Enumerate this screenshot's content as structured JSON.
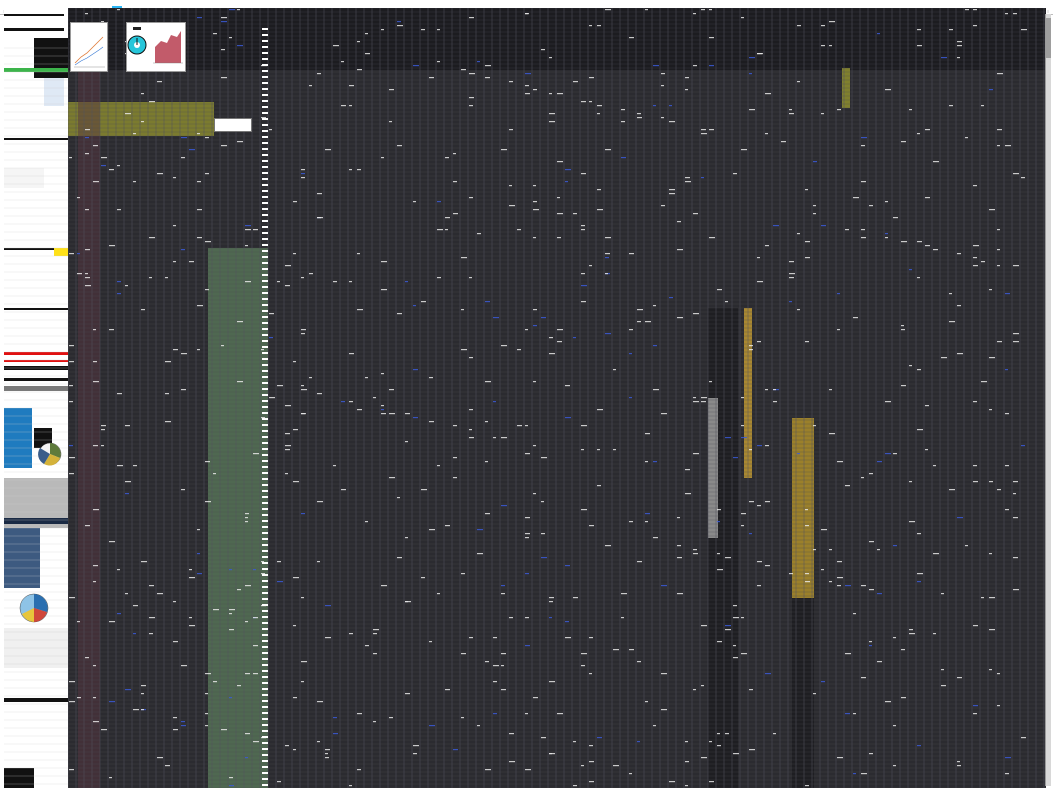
{
  "app": {
    "view": "spreadsheet-overview"
  },
  "colors": {
    "grid_bg": "#2b2b30",
    "cell_line": "#555560",
    "row_line": "#494952",
    "green_band": "#6e9b6e",
    "olive_band": "#8a8a2f",
    "dark_column": "#1e1e22",
    "amber": "#c9a032",
    "mustard": "#b8962a",
    "sidebar_bg": "#ffffff",
    "sidebar_blue": "#1f7bbf",
    "sidebar_black": "#111111",
    "sidebar_red": "#e01010"
  },
  "header_chips": [
    "green",
    "cyan",
    "yellow",
    "magenta",
    "green",
    "yellow"
  ],
  "embedded_charts": [
    {
      "id": "line-chart-1",
      "type": "line"
    },
    {
      "id": "stopwatch-chart",
      "type": "icon-chart"
    },
    {
      "id": "pie-chart-1",
      "type": "pie"
    },
    {
      "id": "pie-chart-2",
      "type": "pie"
    }
  ]
}
